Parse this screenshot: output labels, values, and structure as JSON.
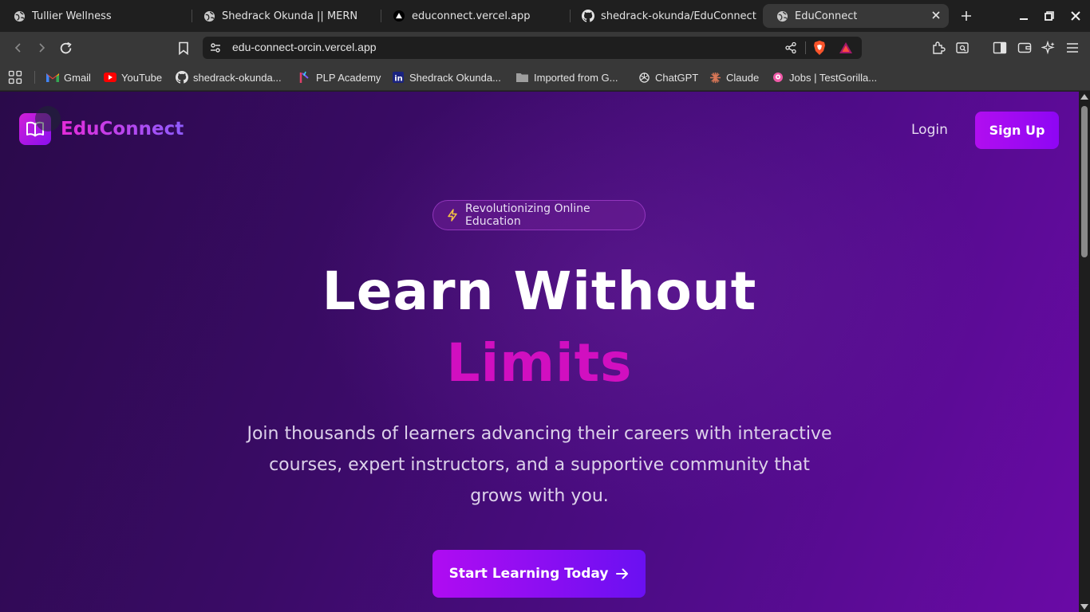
{
  "browser": {
    "tabs": [
      {
        "title": "Tullier Wellness",
        "icon": "globe-icon"
      },
      {
        "title": "Shedrack Okunda || MERN",
        "icon": "globe-icon"
      },
      {
        "title": "educonnect.vercel.app",
        "icon": "vercel-icon"
      },
      {
        "title": "shedrack-okunda/EduConnect",
        "icon": "github-icon"
      },
      {
        "title": "EduConnect",
        "icon": "globe-icon",
        "active": true
      }
    ],
    "url": "edu-connect-orcin.vercel.app",
    "bookmarks": [
      {
        "label": "Gmail",
        "icon": "gmail-icon"
      },
      {
        "label": "YouTube",
        "icon": "youtube-icon"
      },
      {
        "label": "shedrack-okunda...",
        "icon": "github-icon"
      },
      {
        "label": "PLP Academy",
        "icon": "plp-icon"
      },
      {
        "label": "Shedrack Okunda...",
        "icon": "linkedin-icon"
      },
      {
        "label": "Imported from G...",
        "icon": "folder-icon"
      },
      {
        "label": "ChatGPT",
        "icon": "chatgpt-icon"
      },
      {
        "label": "Claude",
        "icon": "claude-icon"
      },
      {
        "label": "Jobs | TestGorilla...",
        "icon": "testgorilla-icon"
      }
    ]
  },
  "site": {
    "brand": "EduConnect",
    "nav": {
      "login": "Login",
      "signup": "Sign Up"
    },
    "badge": "Revolutionizing Online Education",
    "headline_line1": "Learn Without",
    "headline_line2": "Limits",
    "subtext": "Join thousands of learners advancing their careers with interactive courses, expert instructors, and a supportive community that grows with you.",
    "cta": "Start Learning Today"
  },
  "colors": {
    "accent": "#b10ef0",
    "headline_accent": "#d10fc0",
    "background_start": "#2a0a4a",
    "background_end": "#6a0aa6"
  }
}
